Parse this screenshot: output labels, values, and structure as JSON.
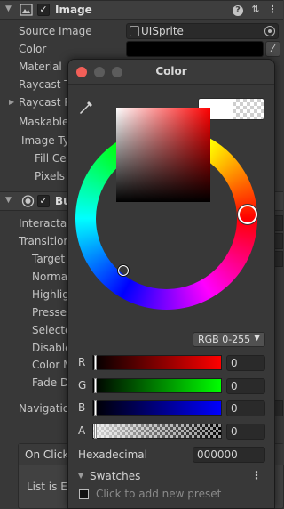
{
  "image_component": {
    "title": "Image",
    "fields": {
      "source_image_label": "Source Image",
      "source_image_value": "UISprite",
      "color_label": "Color",
      "material_label": "Material",
      "raycast_target_label": "Raycast T",
      "raycast_padding_label": "Raycast P",
      "maskable_label": "Maskable",
      "image_type_label": "Image Ty",
      "fill_center_label": "Fill Ce",
      "pixels_label": "Pixels"
    },
    "color_value": "#000000"
  },
  "button_component": {
    "title": "Bu",
    "fields": {
      "interactable_label": "Interactab",
      "transition_label": "Transition",
      "target_label": "Target",
      "normal_label": "Normal",
      "highlighted_label": "Highlig",
      "pressed_label": "Presse",
      "selected_label": "Selecte",
      "disabled_label": "Disable",
      "color_multiplier_label": "Color M",
      "fade_duration_label": "Fade D",
      "navigation_label": "Navigatio"
    },
    "on_click": {
      "header": "On Click",
      "body": "List is Em"
    }
  },
  "color_window": {
    "title": "Color",
    "current_color": "#ffffff",
    "hue_color": "#ff0000",
    "mode": "RGB 0-255",
    "channels": [
      {
        "label": "R",
        "value": "0"
      },
      {
        "label": "G",
        "value": "0"
      },
      {
        "label": "B",
        "value": "0"
      },
      {
        "label": "A",
        "value": "0"
      }
    ],
    "hex_label": "Hexadecimal",
    "hex_value": "000000",
    "swatches_label": "Swatches",
    "add_preset_text": "Click to add new preset"
  }
}
